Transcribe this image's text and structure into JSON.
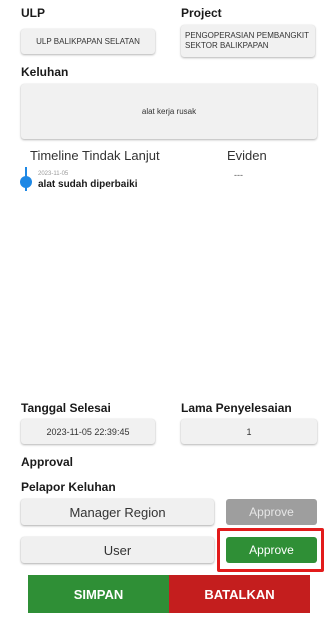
{
  "ulp": {
    "label": "ULP",
    "value": "ULP BALIKPAPAN SELATAN"
  },
  "project": {
    "label": "Project",
    "value_line1": "PENGOPERASIAN PEMBANGKIT",
    "value_line2": "SEKTOR BALIKPAPAN"
  },
  "keluhan": {
    "label": "Keluhan",
    "value": "alat kerja rusak"
  },
  "timeline": {
    "header": "Timeline Tindak Lanjut",
    "eviden_header": "Eviden",
    "items": [
      {
        "date": "2023-11-05",
        "text": "alat sudah diperbaiki",
        "eviden": "---"
      }
    ]
  },
  "tanggal_selesai": {
    "label": "Tanggal Selesai",
    "value": "2023-11-05 22:39:45"
  },
  "lama_penyelesaian": {
    "label": "Lama Penyelesaian",
    "value": "1"
  },
  "approval": {
    "label": "Approval",
    "pelapor_label": "Pelapor Keluhan",
    "rows": [
      {
        "role": "Manager Region",
        "button": "Approve",
        "state": "disabled"
      },
      {
        "role": "User",
        "button": "Approve",
        "state": "active"
      }
    ]
  },
  "actions": {
    "save": "SIMPAN",
    "cancel": "BATALKAN"
  },
  "colors": {
    "approve_active": "#2f8f36",
    "approve_disabled": "#9e9e9e",
    "save": "#2f8f36",
    "cancel": "#c41e1e",
    "timeline_dot": "#1e88e5",
    "highlight": "#e21b1b"
  }
}
